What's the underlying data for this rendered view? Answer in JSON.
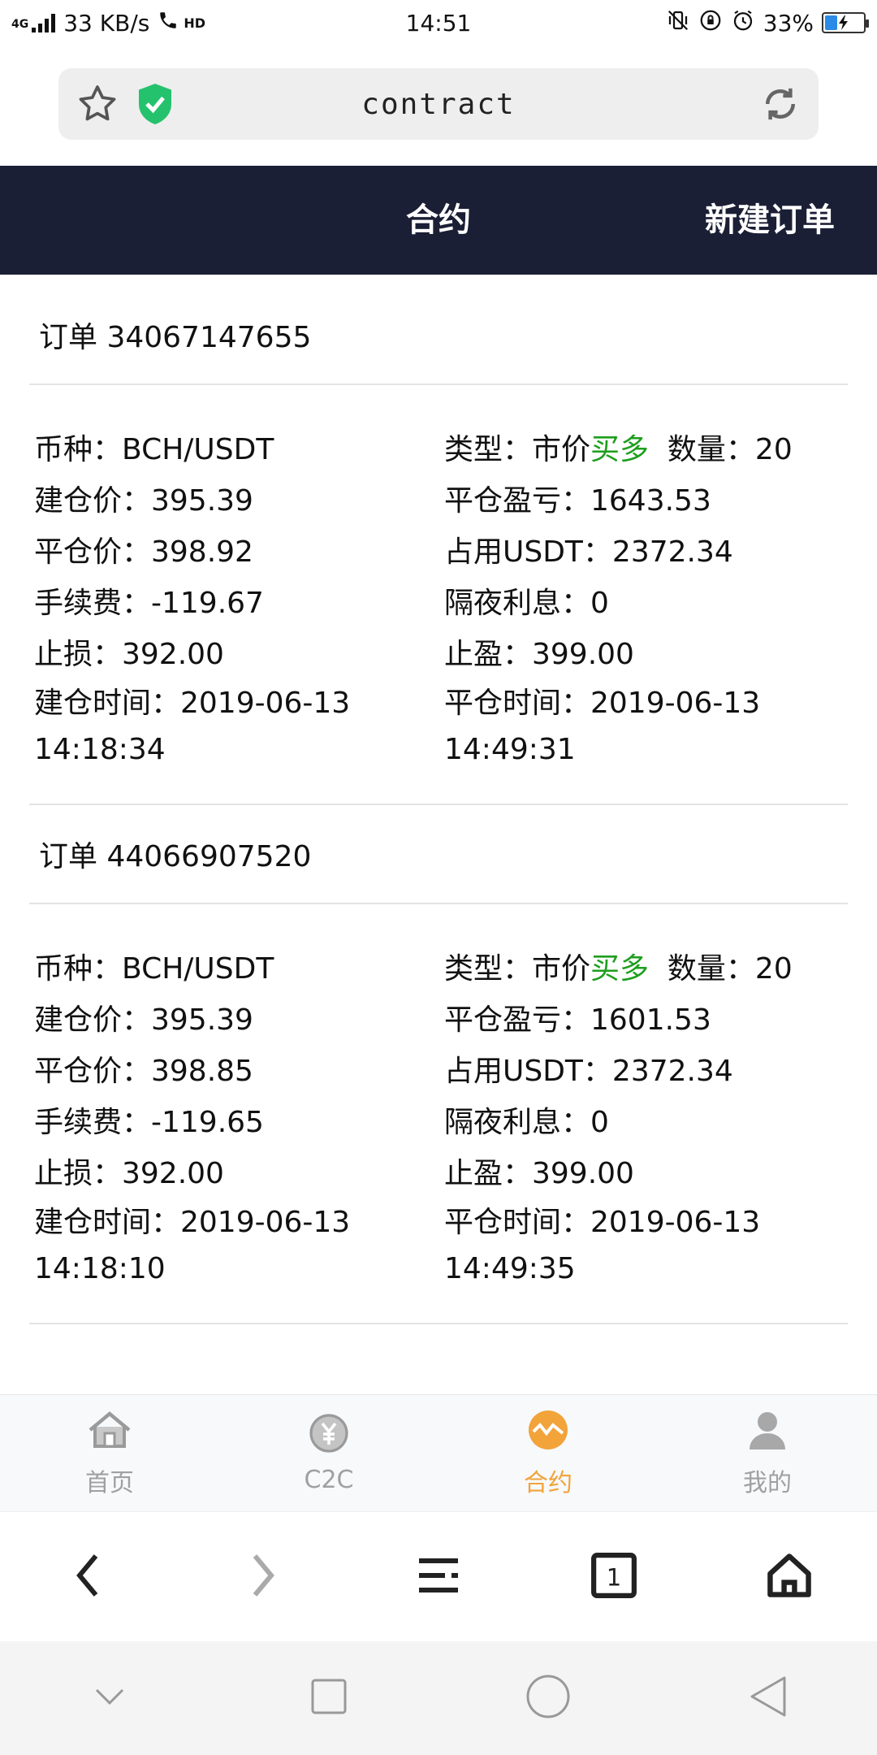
{
  "status_bar": {
    "network": "4G",
    "speed": "33 KB/s",
    "hd": "HD",
    "time": "14:51",
    "battery": "33%",
    "battery_level": 0.33
  },
  "url_bar": {
    "url": "contract"
  },
  "header": {
    "title": "合约",
    "new_order": "新建订单"
  },
  "orders": [
    {
      "title": "订单 34067147655",
      "coin": "币种：BCH/USDT",
      "type_prefix": "类型：市价",
      "type_value": "买多",
      "quantity": "数量：20",
      "open_price": "建仓价：395.39",
      "pnl": "平仓盈亏：1643.53",
      "close_price": "平仓价：398.92",
      "occupied": "占用USDT：2372.34",
      "fee": "手续费：-119.67",
      "overnight": "隔夜利息：0",
      "stop_loss": "止损：392.00",
      "take_profit": "止盈：399.00",
      "open_time": "建仓时间：2019-06-13 14:18:34",
      "close_time": "平仓时间：2019-06-13 14:49:31"
    },
    {
      "title": "订单 44066907520",
      "coin": "币种：BCH/USDT",
      "type_prefix": "类型：市价",
      "type_value": "买多",
      "quantity": "数量：20",
      "open_price": "建仓价：395.39",
      "pnl": "平仓盈亏：1601.53",
      "close_price": "平仓价：398.85",
      "occupied": "占用USDT：2372.34",
      "fee": "手续费：-119.65",
      "overnight": "隔夜利息：0",
      "stop_loss": "止损：392.00",
      "take_profit": "止盈：399.00",
      "open_time": "建仓时间：2019-06-13 14:18:10",
      "close_time": "平仓时间：2019-06-13 14:49:35"
    }
  ],
  "tabs": [
    {
      "label": "首页",
      "icon": "home-icon"
    },
    {
      "label": "C2C",
      "icon": "c2c-icon"
    },
    {
      "label": "合约",
      "icon": "contract-icon"
    },
    {
      "label": "我的",
      "icon": "profile-icon"
    }
  ],
  "colors": {
    "header_bg": "#1b1f35",
    "accent": "#f2a33a",
    "buy_green": "#1e9e1e",
    "shield_green": "#25c26e"
  }
}
